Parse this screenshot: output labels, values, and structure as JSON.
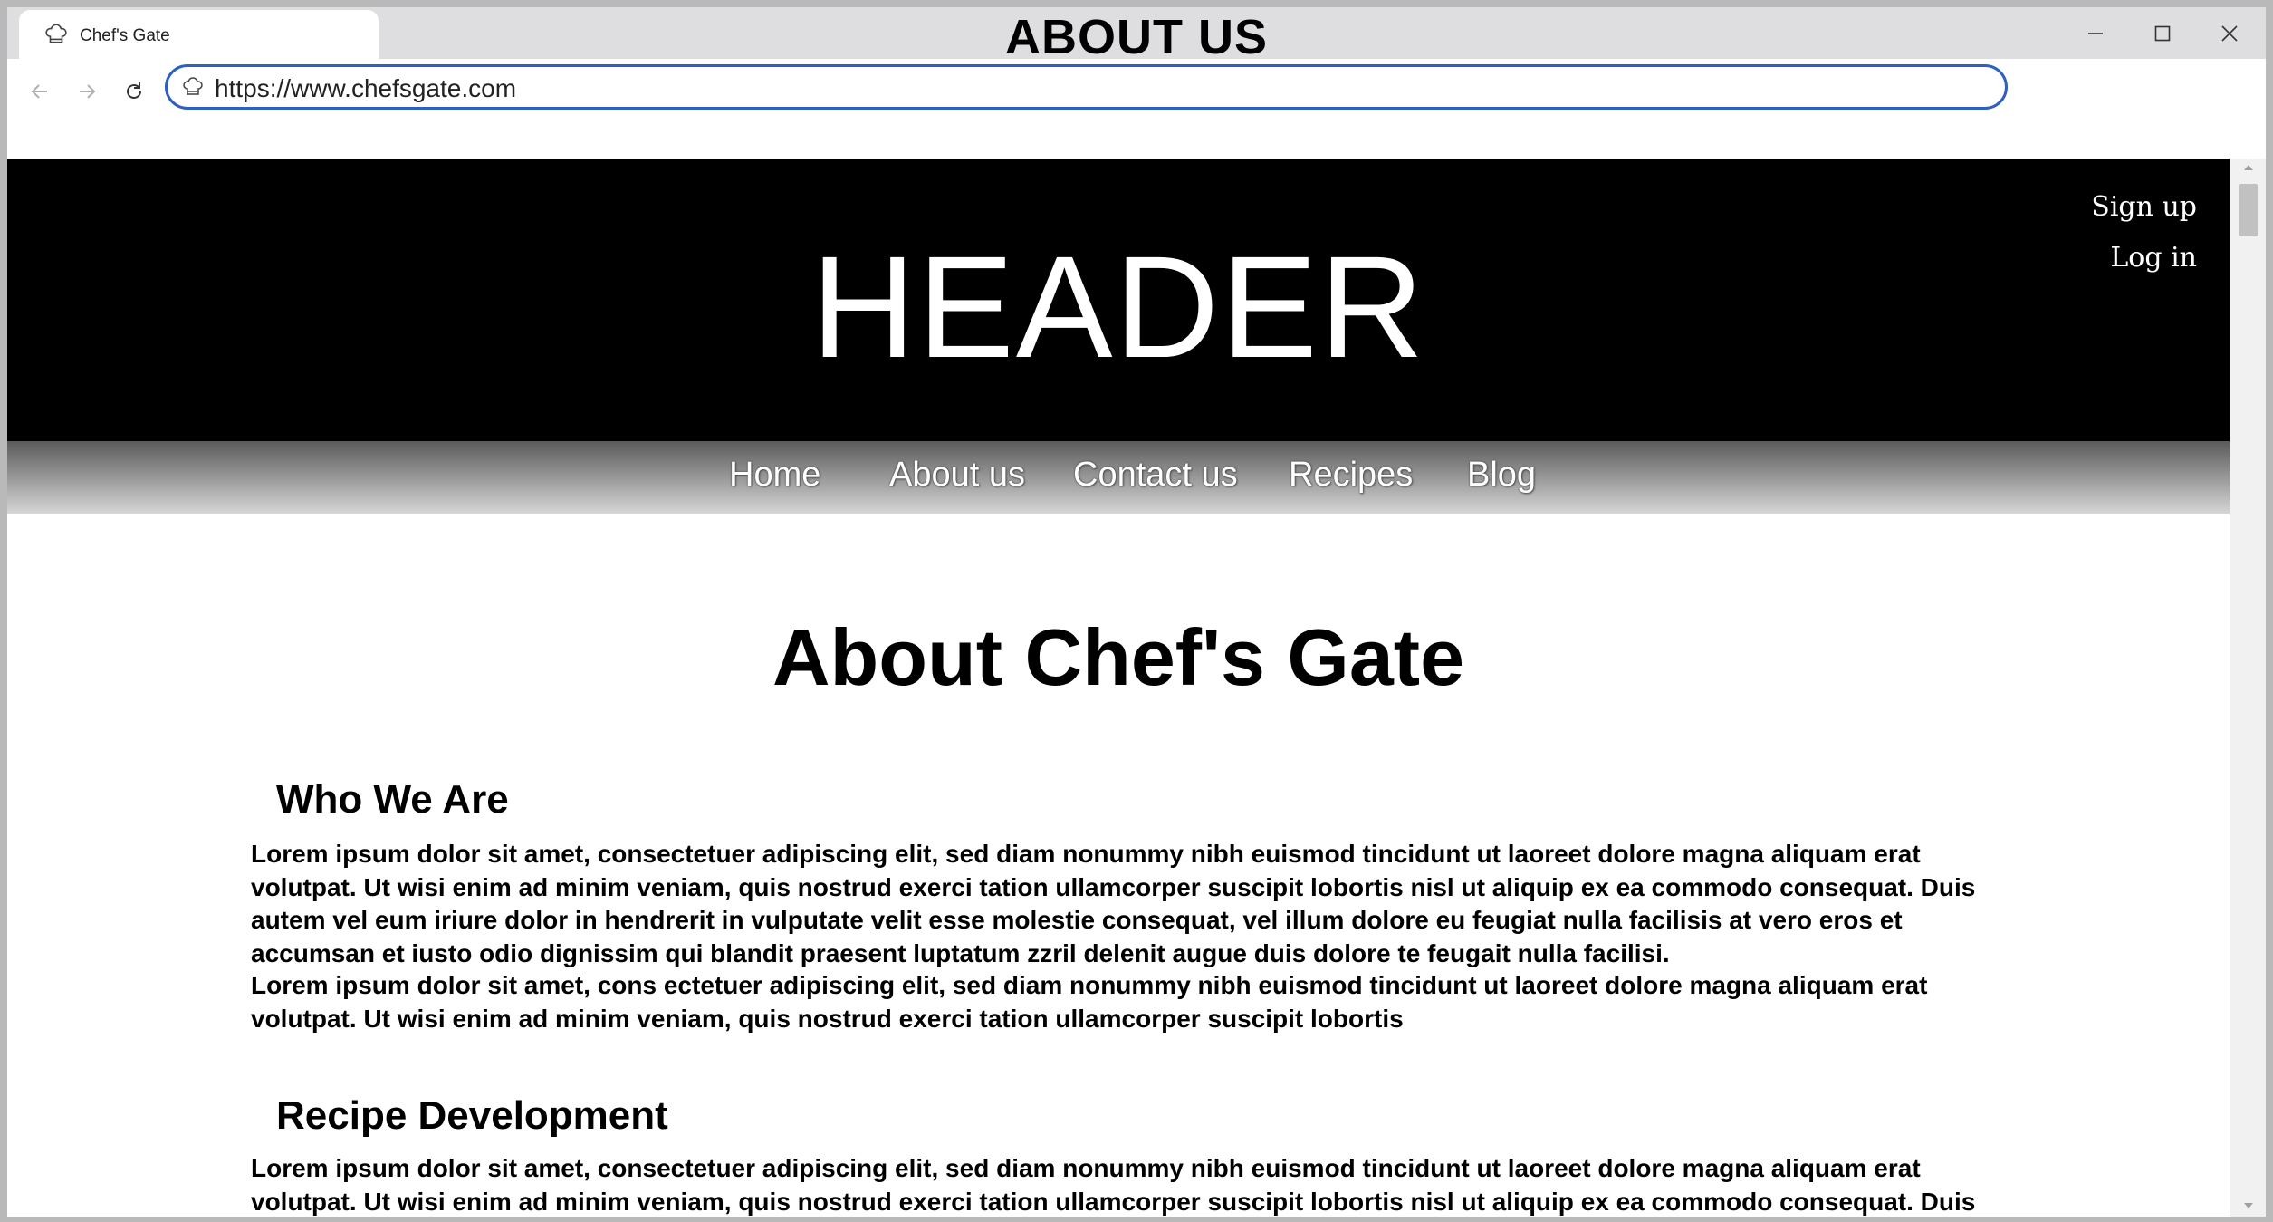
{
  "browser": {
    "tab_title": "Chef's Gate",
    "window_title": "ABOUT US",
    "url": "https://www.chefsgate.com"
  },
  "site": {
    "header_text": "HEADER",
    "auth": {
      "signup": "Sign up",
      "login": "Log in"
    },
    "nav": [
      {
        "label": "Home"
      },
      {
        "label": "About us"
      },
      {
        "label": "Contact us"
      },
      {
        "label": "Recipes"
      },
      {
        "label": "Blog"
      }
    ]
  },
  "content": {
    "title": "About Chef's Gate",
    "sections": [
      {
        "heading": "Who We Are",
        "paragraphs": [
          "Lorem ipsum dolor sit amet, consectetuer adipiscing elit, sed diam nonummy nibh euismod tincidunt ut laoreet dolore magna aliquam erat volutpat. Ut wisi enim ad minim veniam, quis nostrud exerci tation ullamcorper suscipit lobortis nisl ut aliquip ex ea commodo consequat. Duis autem vel eum iriure dolor in hendrerit in vulputate velit esse molestie consequat, vel illum dolore eu feugiat nulla facilisis at vero eros et accumsan et iusto odio dignissim qui blandit praesent luptatum zzril delenit augue duis dolore te feugait nulla facilisi.",
          "Lorem ipsum dolor sit amet, cons ectetuer adipiscing elit, sed diam nonummy nibh euismod tincidunt ut laoreet dolore magna aliquam erat volutpat. Ut wisi enim ad minim veniam, quis nostrud exerci tation ullamcorper suscipit lobortis"
        ]
      },
      {
        "heading": "Recipe Development",
        "paragraphs": [
          "Lorem ipsum dolor sit amet, consectetuer adipiscing elit, sed diam nonummy nibh euismod tincidunt ut laoreet dolore magna aliquam erat volutpat. Ut wisi enim ad minim veniam, quis nostrud exerci tation ullamcorper suscipit lobortis nisl ut aliquip ex ea commodo consequat. Duis autem vel eum iriure"
        ]
      }
    ]
  },
  "colors": {
    "header_bg": "#000000",
    "url_focus_border": "#2e5fc2",
    "nav_gradient_top": "#5a5a5a",
    "nav_gradient_bottom": "#d6d6d6"
  }
}
